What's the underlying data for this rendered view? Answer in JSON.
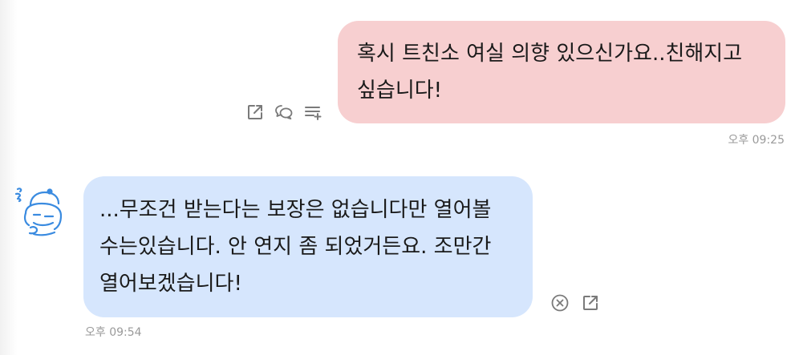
{
  "messages": [
    {
      "side": "sent",
      "text": "혹시 트친소 여실 의향 있으신가요..친해지고\n싶습니다!",
      "time": "오후 09:25",
      "bubble_color": "#f7cfd0",
      "actions": [
        {
          "icon": "share-icon"
        },
        {
          "icon": "comment-icon"
        },
        {
          "icon": "add-to-list-icon"
        }
      ]
    },
    {
      "side": "received",
      "text": "...무조건 받는다는 보장은 없습니다만 열어볼\n수는있습니다. 안 연지 좀 되었거든요. 조만간\n열어보겠습니다!",
      "time": "오후 09:54",
      "bubble_color": "#d6e6fd",
      "avatar_icon": "doodle-avatar-icon",
      "actions": [
        {
          "icon": "close-circle-icon"
        },
        {
          "icon": "share-icon"
        }
      ]
    }
  ],
  "colors": {
    "icon": "#7a7a7a",
    "avatar_stroke": "#3a8be0",
    "timestamp": "#9a9a9a"
  }
}
